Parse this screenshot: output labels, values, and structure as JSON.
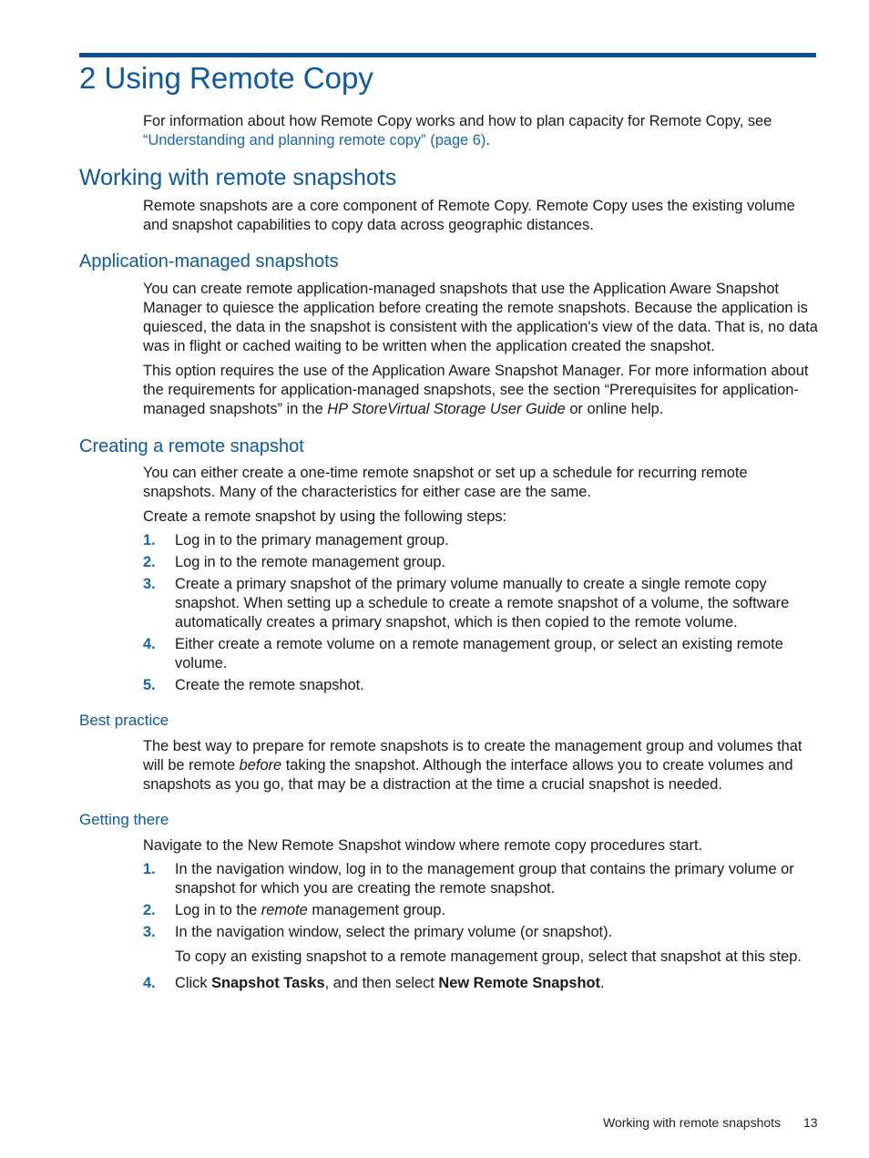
{
  "chapter_title": "2 Using Remote Copy",
  "intro": {
    "text": "For information about how Remote Copy works and how to plan capacity for Remote Copy, see ",
    "link": "“Understanding and planning remote copy” (page 6)",
    "end": "."
  },
  "section_working": {
    "title": "Working with remote snapshots",
    "body": "Remote snapshots are a core component of Remote Copy. Remote Copy uses the existing volume and snapshot capabilities to copy data across geographic distances."
  },
  "section_app_managed": {
    "title": "Application-managed snapshots",
    "para1": "You can create remote application-managed snapshots that use the Application Aware Snapshot Manager to quiesce the application before creating the remote snapshots. Because the application is quiesced, the data in the snapshot is consistent with the application's view of the data. That is, no data was in flight or cached waiting to be written when the application created the snapshot.",
    "para2_a": "This option requires the use of the Application Aware Snapshot Manager. For more information about the requirements for application-managed snapshots, see the section “Prerequisites for application-managed snapshots” in the ",
    "para2_italic": "HP StoreVirtual Storage User Guide",
    "para2_b": " or online help."
  },
  "section_creating": {
    "title": "Creating a remote snapshot",
    "para1": "You can either create a one-time remote snapshot or set up a schedule for recurring remote snapshots. Many of the characteristics for either case are the same.",
    "para2": "Create a remote snapshot by using the following steps:",
    "steps": [
      {
        "num": "1.",
        "text": "Log in to the primary management group."
      },
      {
        "num": "2.",
        "text": "Log in to the remote management group."
      },
      {
        "num": "3.",
        "text": "Create a primary snapshot of the primary volume manually to create a single remote copy snapshot. When setting up a schedule to create a remote snapshot of a volume, the software automatically creates a primary snapshot, which is then copied to the remote volume."
      },
      {
        "num": "4.",
        "text": "Either create a remote volume on a remote management group, or select an existing remote volume."
      },
      {
        "num": "5.",
        "text": "Create the remote snapshot."
      }
    ]
  },
  "section_best_practice": {
    "title": "Best practice",
    "body_a": "The best way to prepare for remote snapshots is to create the management group and volumes that will be remote ",
    "body_italic": "before",
    "body_b": " taking the snapshot. Although the interface allows you to create volumes and snapshots as you go, that may be a distraction at the time a crucial snapshot is needed."
  },
  "section_getting_there": {
    "title": "Getting there",
    "intro": "Navigate to the New Remote Snapshot window where remote copy procedures start.",
    "step1_num": "1.",
    "step1_text": "In the navigation window, log in to the management group that contains the primary volume or snapshot for which you are creating the remote snapshot.",
    "step2_num": "2.",
    "step2_a": "Log in to the ",
    "step2_italic": "remote",
    "step2_b": " management group.",
    "step3_num": "3.",
    "step3_text": "In the navigation window, select the primary volume (or snapshot).",
    "step3_note": "To copy an existing snapshot to a remote management group, select that snapshot at this step.",
    "step4_num": "4.",
    "step4_a": "Click ",
    "step4_bold1": "Snapshot Tasks",
    "step4_b": ", and then select ",
    "step4_bold2": "New Remote Snapshot",
    "step4_c": "."
  },
  "footer": {
    "section": "Working with remote snapshots",
    "page": "13"
  }
}
